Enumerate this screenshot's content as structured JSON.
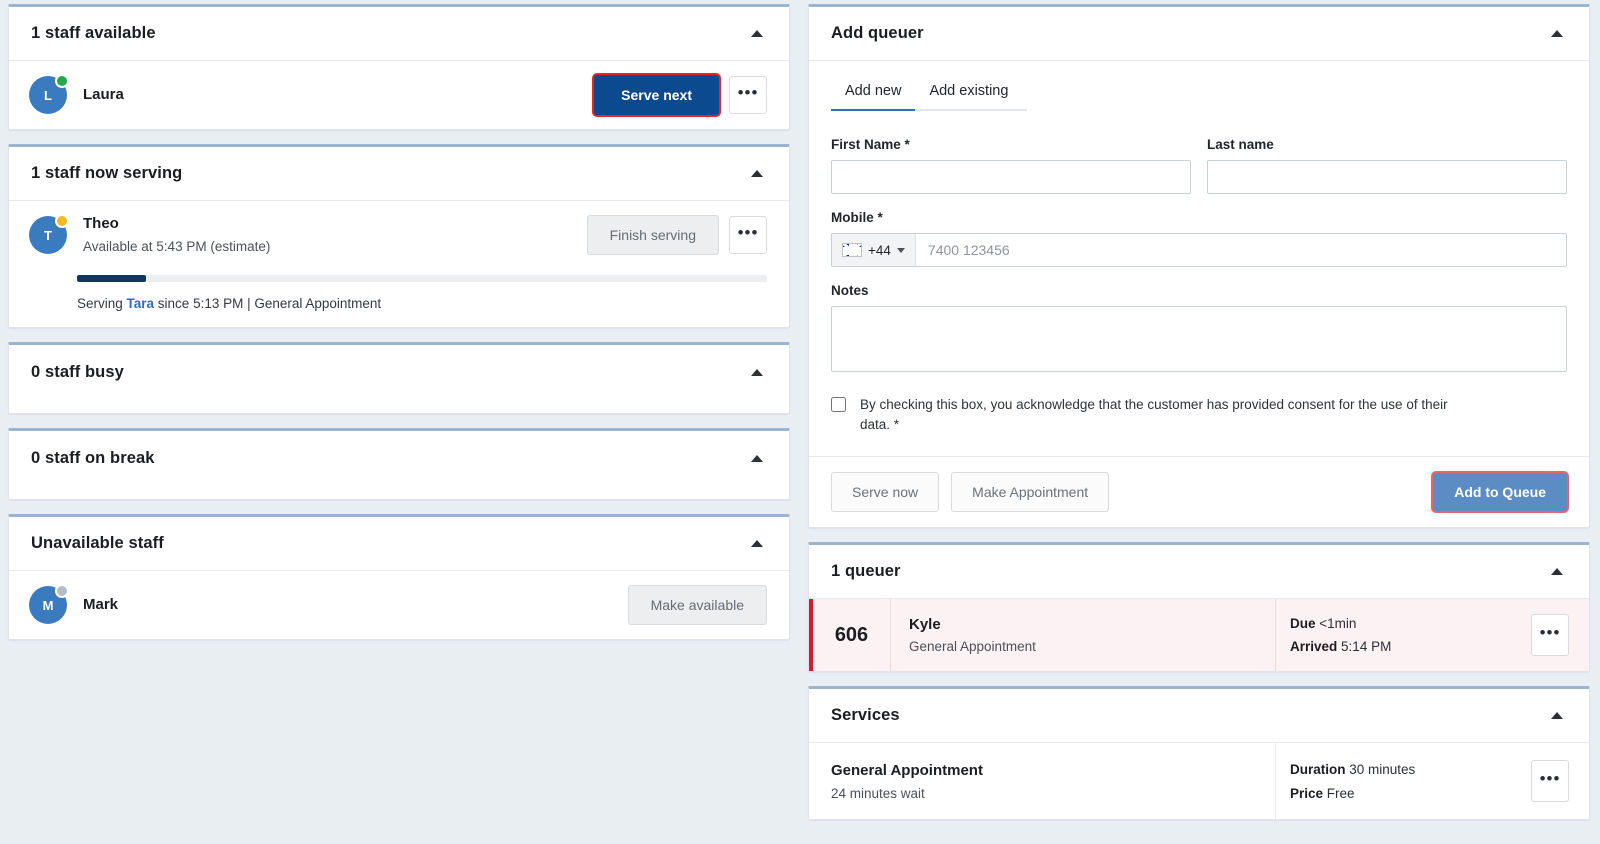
{
  "left": {
    "available_panel": {
      "title": "1 staff available",
      "collapse_icon": "chevron-up-icon",
      "staff": [
        {
          "name": "Laura",
          "initial": "L",
          "status": "green",
          "primary_action": "Serve next",
          "kebab": "•••"
        }
      ]
    },
    "serving_panel": {
      "title": "1 staff now serving",
      "collapse_icon": "chevron-up-icon",
      "staff": [
        {
          "name": "Theo",
          "initial": "T",
          "status": "amber",
          "availability": "Available at 5:43 PM (estimate)",
          "progress_percent": 10,
          "serving_prefix": "Serving ",
          "serving_customer": "Tara",
          "serving_suffix": " since 5:13 PM | General Appointment",
          "primary_action": "Finish serving",
          "kebab": "•••"
        }
      ]
    },
    "busy_panel": {
      "title": "0 staff busy",
      "collapse_icon": "chevron-up-icon"
    },
    "break_panel": {
      "title": "0 staff on break",
      "collapse_icon": "chevron-up-icon"
    },
    "unavailable_panel": {
      "title": "Unavailable staff",
      "collapse_icon": "chevron-up-icon",
      "staff": [
        {
          "name": "Mark",
          "initial": "M",
          "status": "grey",
          "primary_action": "Make available"
        }
      ]
    }
  },
  "right": {
    "add_queuer": {
      "title": "Add queuer",
      "collapse_icon": "chevron-up-icon",
      "tabs": [
        {
          "label": "Add new",
          "active": true
        },
        {
          "label": "Add existing",
          "active": false
        }
      ],
      "fields": {
        "first_name_label": "First Name *",
        "first_name_value": "",
        "first_name_placeholder": "",
        "last_name_label": "Last name",
        "last_name_value": "",
        "last_name_placeholder": "",
        "mobile_label": "Mobile *",
        "mobile_dialcode": "+44",
        "mobile_flag": "uk-flag-icon",
        "mobile_placeholder": "7400 123456",
        "mobile_value": "",
        "notes_label": "Notes",
        "notes_value": "",
        "notes_placeholder": ""
      },
      "consent": {
        "checked": false,
        "text": "By checking this box, you acknowledge that the customer has provided consent for the use of their data. *"
      },
      "footer": {
        "serve_now": "Serve now",
        "make_appointment": "Make Appointment",
        "add_to_queue": "Add to Queue"
      }
    },
    "queuers": {
      "title": "1 queuer",
      "collapse_icon": "chevron-up-icon",
      "rows": [
        {
          "ticket": "606",
          "name": "Kyle",
          "service": "General Appointment",
          "due_label": "Due",
          "due_value": "<1min",
          "arrived_label": "Arrived",
          "arrived_value": "5:14 PM",
          "kebab": "•••"
        }
      ]
    },
    "services": {
      "title": "Services",
      "collapse_icon": "chevron-up-icon",
      "rows": [
        {
          "name": "General Appointment",
          "wait": "24 minutes wait",
          "duration_label": "Duration",
          "duration_value": "30 minutes",
          "price_label": "Price",
          "price_value": "Free",
          "kebab": "•••"
        }
      ]
    }
  },
  "colors": {
    "accent_primary": "#0b4a8f",
    "accent_secondary": "#5b8cc4",
    "highlight": "#e8232a",
    "status_available": "#21a94b",
    "status_serving": "#f5b921",
    "status_unavailable": "#b4bcc6",
    "queue_alert": "#d81c27"
  }
}
